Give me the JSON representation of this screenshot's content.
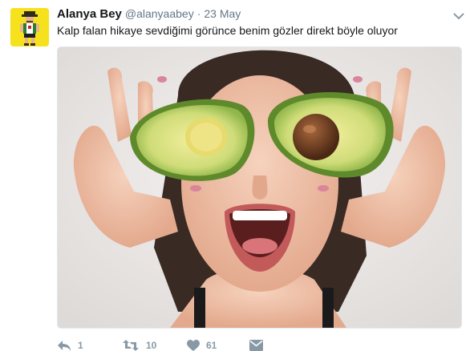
{
  "tweet": {
    "author_name": "Alanya Bey",
    "handle": "@alanyaabey",
    "separator": "·",
    "date": "23 May",
    "text": "Kalp falan hikaye sevdiğimi görünce benim gözler direkt böyle oluyor"
  },
  "media": {
    "description_icon": "photo-woman-avocado-eyes"
  },
  "actions": {
    "reply_count": "1",
    "retweet_count": "10",
    "like_count": "61"
  },
  "colors": {
    "secondary_text": "#657786",
    "action_gray": "#8899a6",
    "avatar_bg": "#f5e21c"
  }
}
